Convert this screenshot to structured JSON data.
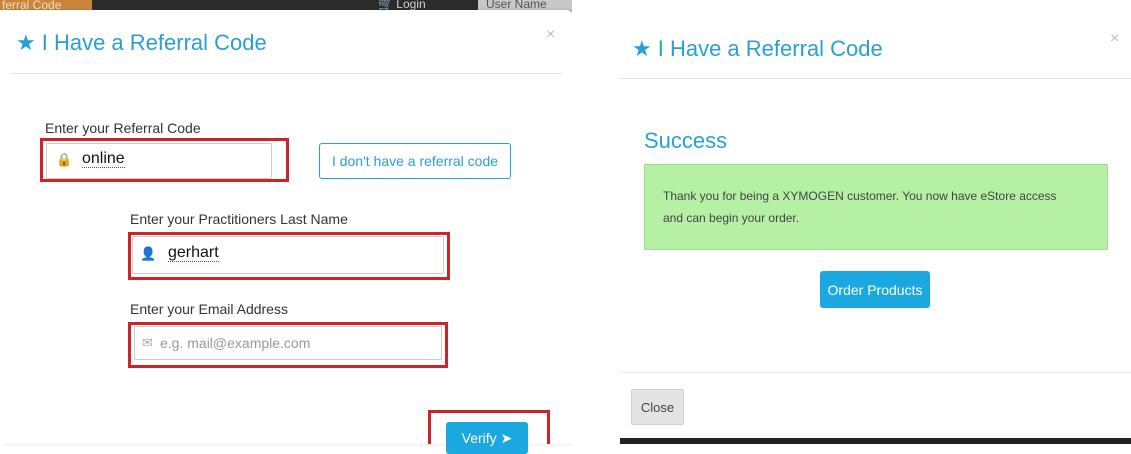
{
  "background_page": {
    "left_tab": "ferral Code",
    "cart_icon": "cart-icon",
    "login_label": "Login",
    "user_name_label": "User Name"
  },
  "referral_modal": {
    "title": "I Have a Referral Code",
    "close": "×",
    "referral_code_label": "Enter your Referral Code",
    "referral_code_value": "online",
    "no_code_button": "I don't have a referral code",
    "last_name_label": "Enter your Practitioners Last Name",
    "last_name_value": "gerhart",
    "email_label": "Enter your Email Address",
    "email_placeholder": "e.g. mail@example.com",
    "verify_button": "Verify"
  },
  "success_modal": {
    "title": "I Have a Referral Code",
    "close": "×",
    "heading": "Success",
    "message_line1": "Thank you for being a XYMOGEN customer. You now have eStore access",
    "message_line2": "and can begin your order.",
    "order_button": "Order Products",
    "close_button": "Close"
  },
  "colors": {
    "accent": "#2a9fd6",
    "button_blue": "#1ba8e0",
    "highlight_red": "#c9252b",
    "success_green": "#b5f0a4"
  }
}
